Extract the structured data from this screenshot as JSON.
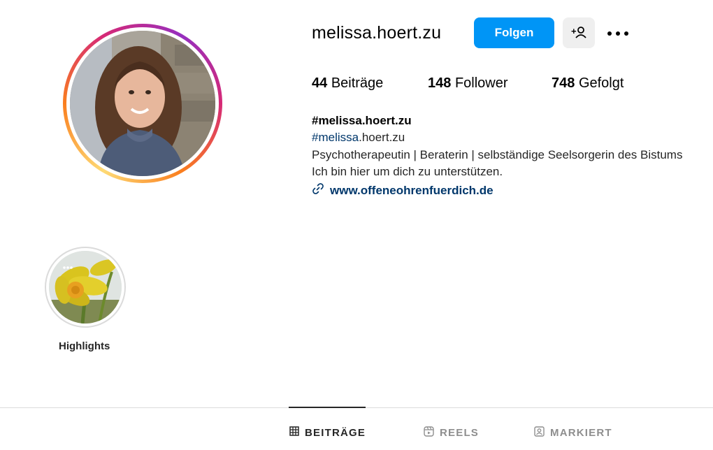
{
  "profile": {
    "username": "melissa.hoert.zu",
    "follow_label": "Folgen",
    "stats": {
      "posts_count": "44",
      "posts_label": "Beiträge",
      "followers_count": "148",
      "followers_label": "Follower",
      "following_count": "748",
      "following_label": "Gefolgt"
    },
    "bio": {
      "name": "#melissa.hoert.zu",
      "hashtag": "#melissa",
      "hashtag_rest": ".hoert.zu",
      "line1": "Psychotherapeutin | Beraterin | selbständige Seelsorgerin des Bistums",
      "line2": "Ich bin hier um dich zu unterstützen.",
      "link": "www.offeneohrenfuerdich.de"
    }
  },
  "highlights": [
    {
      "label": "Highlights"
    }
  ],
  "tabs": [
    {
      "label": "BEITRÄGE",
      "icon": "grid-icon",
      "active": true
    },
    {
      "label": "REELS",
      "icon": "reels-icon",
      "active": false
    },
    {
      "label": "MARKIERT",
      "icon": "tagged-icon",
      "active": false
    }
  ],
  "colors": {
    "accent": "#0095f6",
    "link": "#00376b",
    "text": "#262626",
    "secondary_button": "#efefef"
  }
}
